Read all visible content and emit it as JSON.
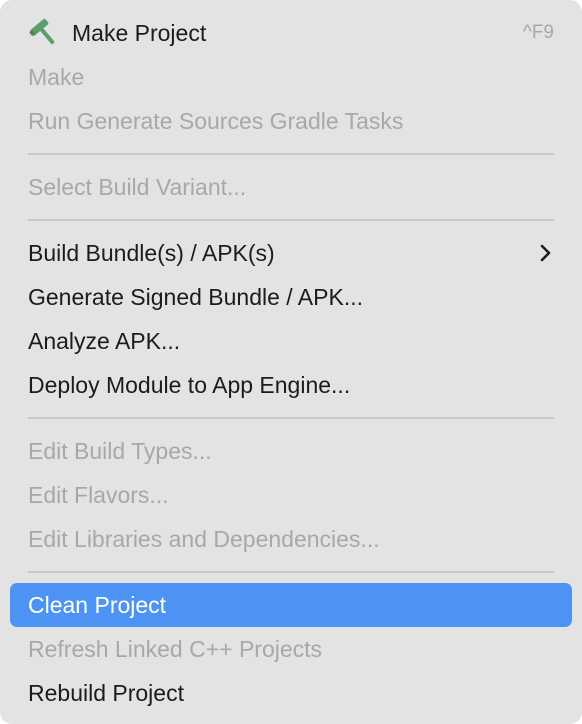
{
  "menu": {
    "make_project": {
      "label": "Make Project",
      "shortcut": "^F9"
    },
    "make": "Make",
    "run_generate": "Run Generate Sources Gradle Tasks",
    "select_build_variant": "Select Build Variant...",
    "build_bundle": "Build Bundle(s) / APK(s)",
    "generate_signed": "Generate Signed Bundle / APK...",
    "analyze_apk": "Analyze APK...",
    "deploy_module": "Deploy Module to App Engine...",
    "edit_build_types": "Edit Build Types...",
    "edit_flavors": "Edit Flavors...",
    "edit_libraries": "Edit Libraries and Dependencies...",
    "clean_project": "Clean Project",
    "refresh_linked": "Refresh Linked C++ Projects",
    "rebuild_project": "Rebuild Project"
  },
  "icons": {
    "make_project": "hammer-icon",
    "submenu": "chevron-right-icon"
  },
  "colors": {
    "highlight": "#4d93f3",
    "hammer": "#5d9e6a",
    "disabled_text": "#a8a8a8"
  }
}
